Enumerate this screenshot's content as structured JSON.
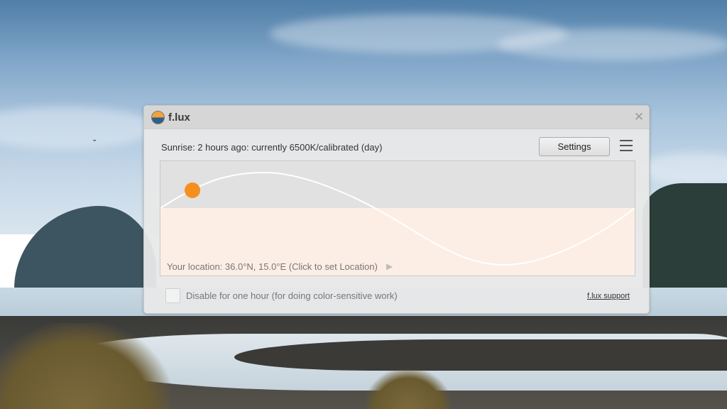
{
  "window": {
    "title": "f.lux",
    "close_glyph": "✕",
    "logo_icon": "flux-logo-icon"
  },
  "status": {
    "text": "Sunrise: 2 hours ago: currently 6500K/calibrated (day)"
  },
  "toolbar": {
    "settings_label": "Settings",
    "menu_icon": "hamburger-menu-icon"
  },
  "graph": {
    "location_text": "Your location: 36.0°N, 15.0°E (Click to set Location)",
    "location_arrow": "▶",
    "colors": {
      "day_band": "#e1e1e1",
      "night_band": "#fdeee5",
      "curve": "#ffffff",
      "sun_marker": "#f5901f"
    }
  },
  "footer": {
    "disable_label": "Disable for one hour (for doing color-sensitive work)",
    "disable_checked": false,
    "support_link": "f.lux support"
  }
}
